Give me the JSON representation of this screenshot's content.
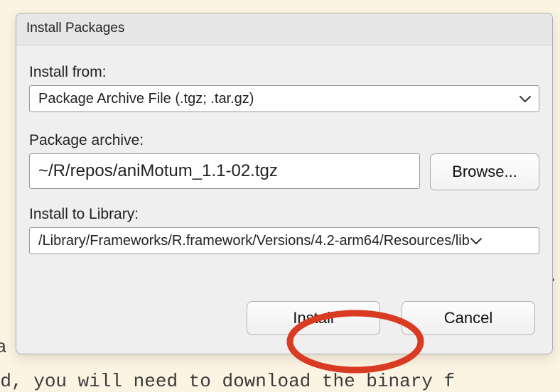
{
  "dialog": {
    "title": "Install Packages",
    "install_from_label": "Install from:",
    "install_from_value": "Package Archive File (.tgz; .tar.gz)",
    "archive_label": "Package archive:",
    "archive_path": "~/R/repos/aniMotum_1.1-02.tgz",
    "browse_label": "Browse...",
    "library_label": "Install to Library:",
    "library_value": "/Library/Frameworks/R.framework/Versions/4.2-arm64/Resources/lib",
    "install_label": "Install",
    "cancel_label": "Cancel"
  },
  "backdrop": {
    "line1": "stead, you will need to download the binary f",
    "line2": "a                                             e",
    "line3": "stead, you will need to download the binary f",
    "dot": "."
  },
  "annotation": {
    "ellipse_color": "#D93A22",
    "ellipse_stroke_width": 9
  }
}
